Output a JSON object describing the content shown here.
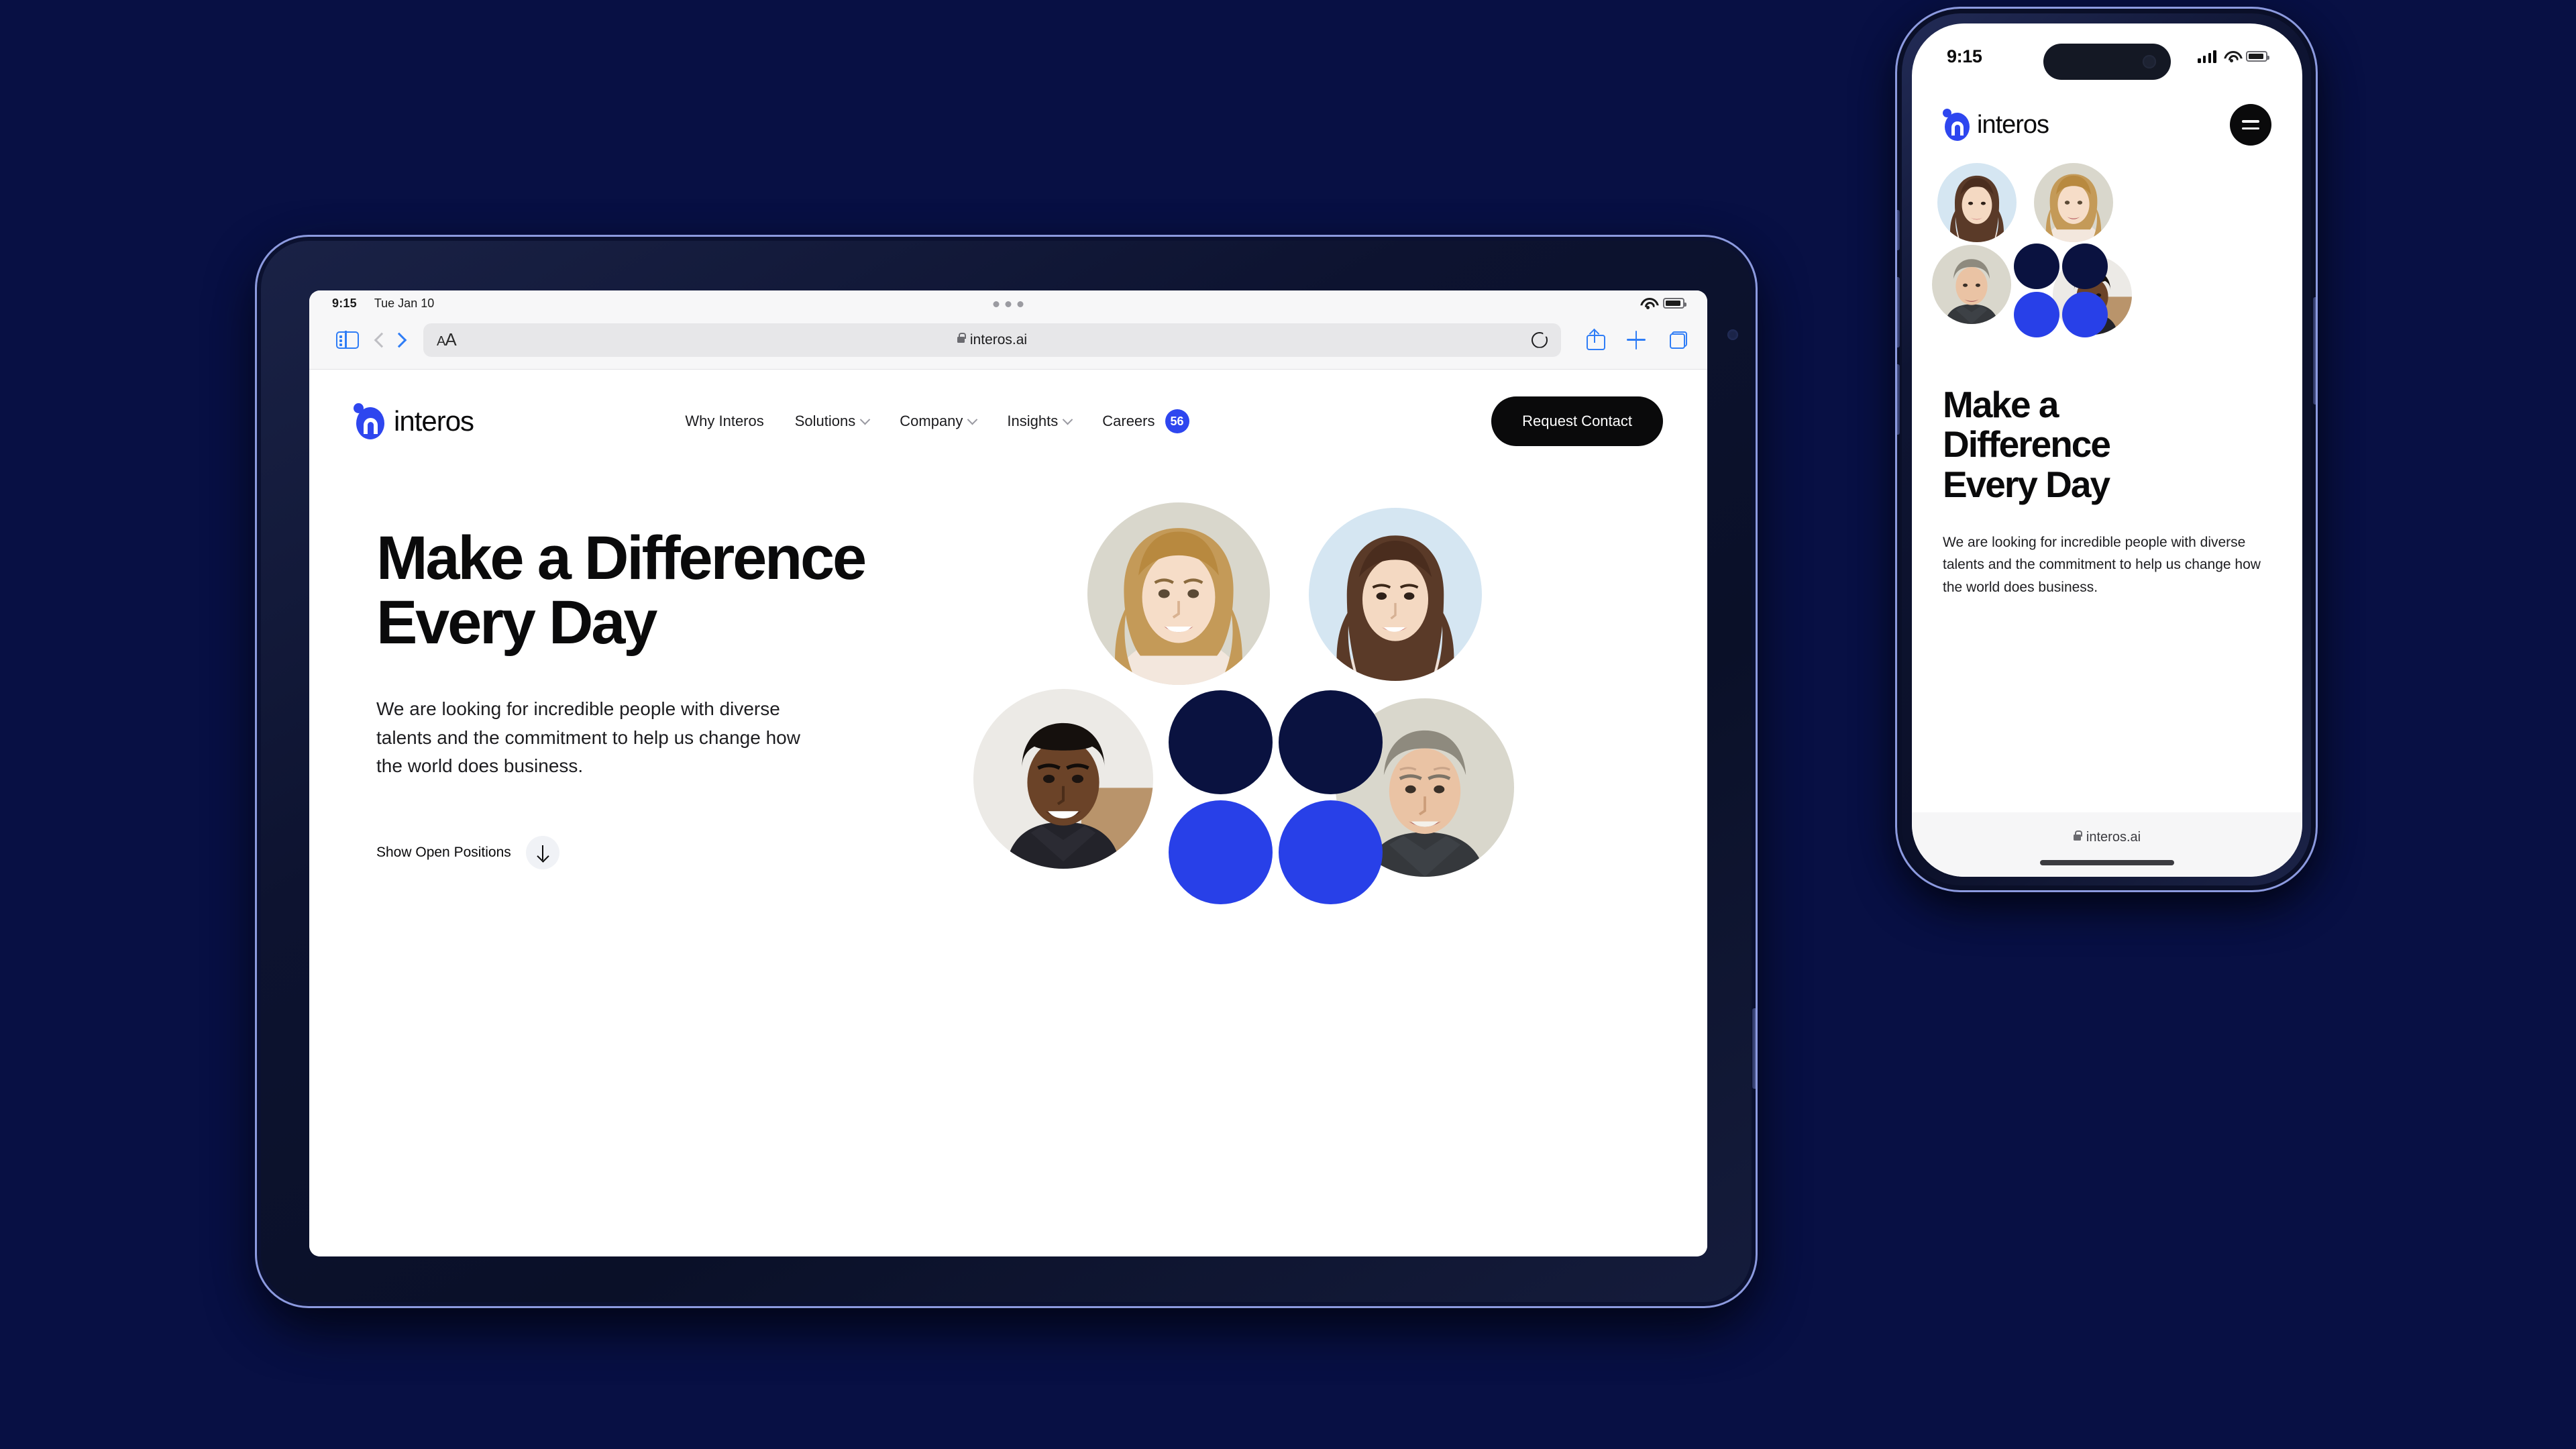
{
  "background_color": "#081044",
  "brand": {
    "name": "interos",
    "accent_blue": "#2e46ef",
    "navy": "#0a1240",
    "bright_blue": "#2840e8",
    "black": "#0a0a0b"
  },
  "tablet": {
    "status_bar": {
      "time": "9:15",
      "date": "Tue Jan 10",
      "multitask_icon": "three-dots-icon",
      "wifi_icon": "wifi-icon",
      "battery_icon": "battery-icon"
    },
    "browser": {
      "sidebar_icon": "sidebar-toggle-icon",
      "back_icon": "chevron-left-icon",
      "forward_icon": "chevron-right-icon",
      "text_size_label": "AA",
      "lock_icon": "lock-icon",
      "url": "interos.ai",
      "reload_icon": "reload-icon",
      "share_icon": "share-icon",
      "new_tab_icon": "plus-icon",
      "tabs_icon": "tabs-overview-icon"
    },
    "site": {
      "logo_text": "interos",
      "nav": [
        {
          "label": "Why Interos",
          "has_chevron": false,
          "badge": null
        },
        {
          "label": "Solutions",
          "has_chevron": true,
          "badge": null
        },
        {
          "label": "Company",
          "has_chevron": true,
          "badge": null
        },
        {
          "label": "Insights",
          "has_chevron": true,
          "badge": null
        },
        {
          "label": "Careers",
          "has_chevron": false,
          "badge": "56"
        }
      ],
      "cta_button": "Request Contact",
      "heading_line1": "Make a Difference",
      "heading_line2": "Every Day",
      "lead": "We are looking for incredible people with diverse talents and the commitment to help us change how the world does business.",
      "show_positions_label": "Show Open Positions",
      "show_positions_icon": "arrow-down-icon",
      "cluster": [
        {
          "name": "portrait-blonde-woman",
          "type": "photo"
        },
        {
          "name": "portrait-asian-woman",
          "type": "photo"
        },
        {
          "name": "portrait-black-man",
          "type": "photo"
        },
        {
          "name": "portrait-older-man",
          "type": "photo"
        },
        {
          "name": "circle-navy-left",
          "type": "solid",
          "color": "#0a1240"
        },
        {
          "name": "circle-navy-right",
          "type": "solid",
          "color": "#0a1240"
        },
        {
          "name": "circle-blue-left",
          "type": "solid",
          "color": "#2840e8"
        },
        {
          "name": "circle-blue-right",
          "type": "solid",
          "color": "#2840e8"
        }
      ]
    }
  },
  "phone": {
    "status_bar": {
      "time": "9:15",
      "signal_icon": "cellular-signal-icon",
      "wifi_icon": "wifi-icon",
      "battery_icon": "battery-icon"
    },
    "site": {
      "logo_text": "interos",
      "menu_icon": "hamburger-menu-icon",
      "heading_line1": "Make a",
      "heading_line2": "Difference",
      "heading_line3": "Every Day",
      "lead": "We are looking for incredible people with diverse talents and the commitment to help us change how the world does business.",
      "cluster": [
        {
          "name": "portrait-asian-woman",
          "type": "photo"
        },
        {
          "name": "portrait-blonde-woman",
          "type": "photo"
        },
        {
          "name": "portrait-older-man",
          "type": "photo"
        },
        {
          "name": "portrait-black-man",
          "type": "photo"
        },
        {
          "name": "circle-navy-left",
          "type": "solid",
          "color": "#0a1240"
        },
        {
          "name": "circle-navy-right",
          "type": "solid",
          "color": "#0a1240"
        },
        {
          "name": "circle-blue-left",
          "type": "solid",
          "color": "#2840e8"
        },
        {
          "name": "circle-blue-right",
          "type": "solid",
          "color": "#2840e8"
        }
      ]
    },
    "browser_bar": {
      "lock_icon": "lock-icon",
      "url": "interos.ai",
      "home_indicator": "home-indicator"
    }
  }
}
